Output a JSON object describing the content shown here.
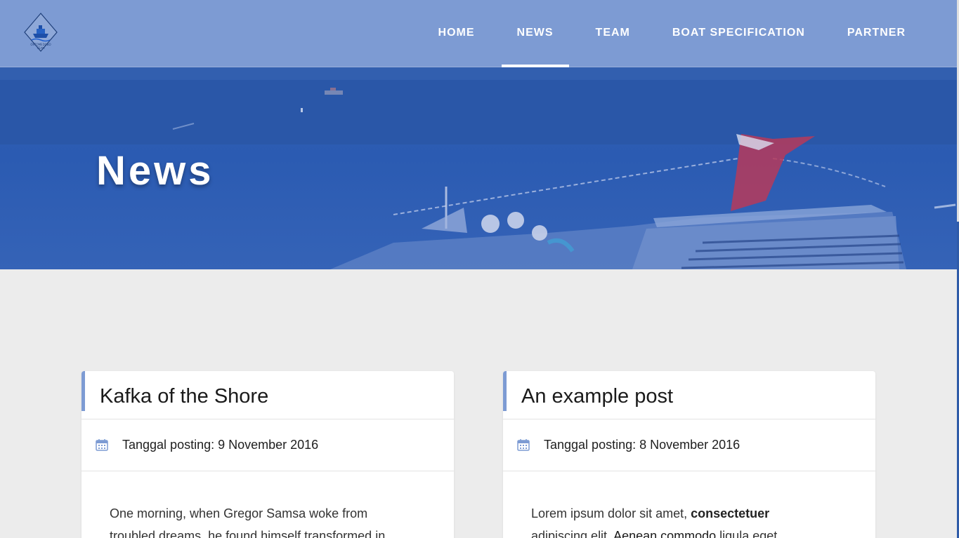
{
  "nav": {
    "logo_text": "ORTOMEDOBO TEAM",
    "items": [
      {
        "label": "HOME",
        "active": false
      },
      {
        "label": "NEWS",
        "active": true
      },
      {
        "label": "TEAM",
        "active": false
      },
      {
        "label": "BOAT SPECIFICATION",
        "active": false
      },
      {
        "label": "PARTNER",
        "active": false
      }
    ]
  },
  "hero": {
    "title": "News"
  },
  "posts": [
    {
      "title": "Kafka of the Shore",
      "date": "Tanggal posting: 9 November 2016",
      "excerpt_line1": "One morning, when Gregor Samsa woke from",
      "excerpt_line2": "troubled dreams, he found himself transformed in"
    },
    {
      "title": "An example post",
      "date": "Tanggal posting: 8 November 2016",
      "excerpt_a": "Lorem ipsum dolor sit amet, ",
      "excerpt_bold": "consectetuer",
      "excerpt_b": "adipiscing elit. ",
      "excerpt_link": "Aenean commodo",
      "excerpt_c": " ligula eget"
    }
  ],
  "colors": {
    "nav_bg": "#7d9bd3",
    "hero_bg": "#2f5eb0",
    "accent": "#7d9bd3",
    "page_bg": "#ececec"
  }
}
